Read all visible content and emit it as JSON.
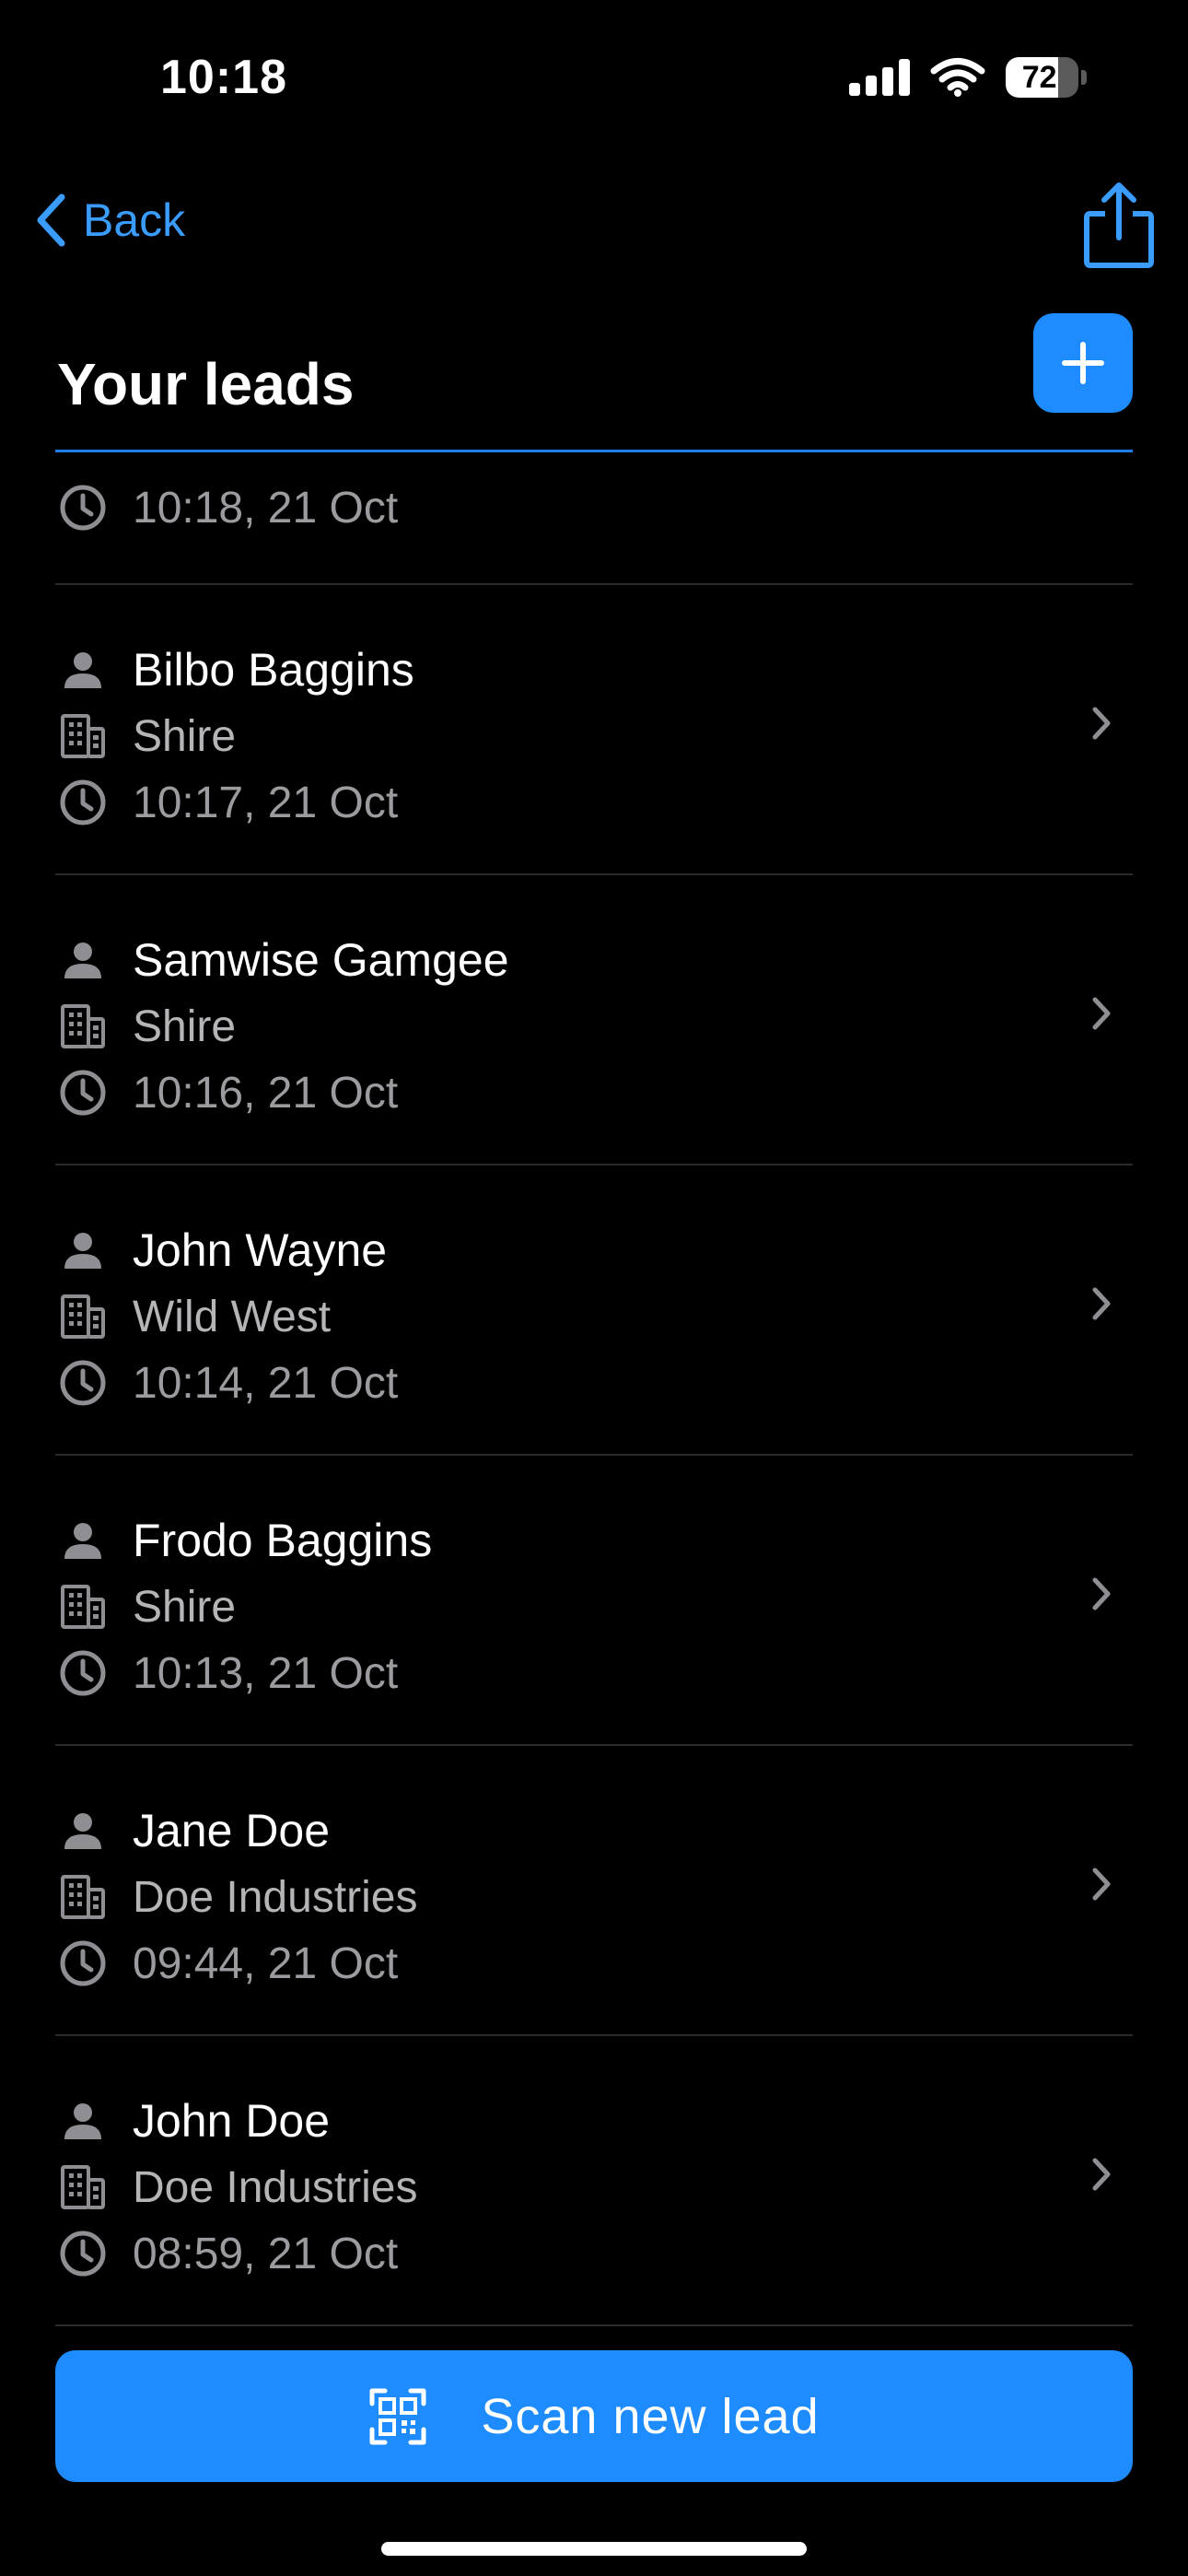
{
  "status_bar": {
    "time": "10:18",
    "battery_level": "72",
    "battery_fraction": 0.72
  },
  "nav": {
    "back_label": "Back",
    "share_icon": "share-icon"
  },
  "header": {
    "title": "Your leads",
    "add_icon": "plus-icon"
  },
  "partial_item": {
    "time": "10:18, 21 Oct"
  },
  "leads": [
    {
      "name": "Bilbo Baggins",
      "company": "Shire",
      "time": "10:17, 21 Oct"
    },
    {
      "name": "Samwise Gamgee",
      "company": "Shire",
      "time": "10:16, 21 Oct"
    },
    {
      "name": "John Wayne",
      "company": "Wild West",
      "time": "10:14, 21 Oct"
    },
    {
      "name": "Frodo Baggins",
      "company": "Shire",
      "time": "10:13, 21 Oct"
    },
    {
      "name": "Jane Doe",
      "company": "Doe Industries",
      "time": "09:44, 21 Oct"
    },
    {
      "name": "John Doe",
      "company": "Doe Industries",
      "time": "08:59, 21 Oct"
    }
  ],
  "scan_button": {
    "label": "Scan new lead",
    "icon": "qr-scan-icon"
  },
  "colors": {
    "accent": "#1e8cff",
    "link": "#3a9cff",
    "background": "#000000"
  }
}
